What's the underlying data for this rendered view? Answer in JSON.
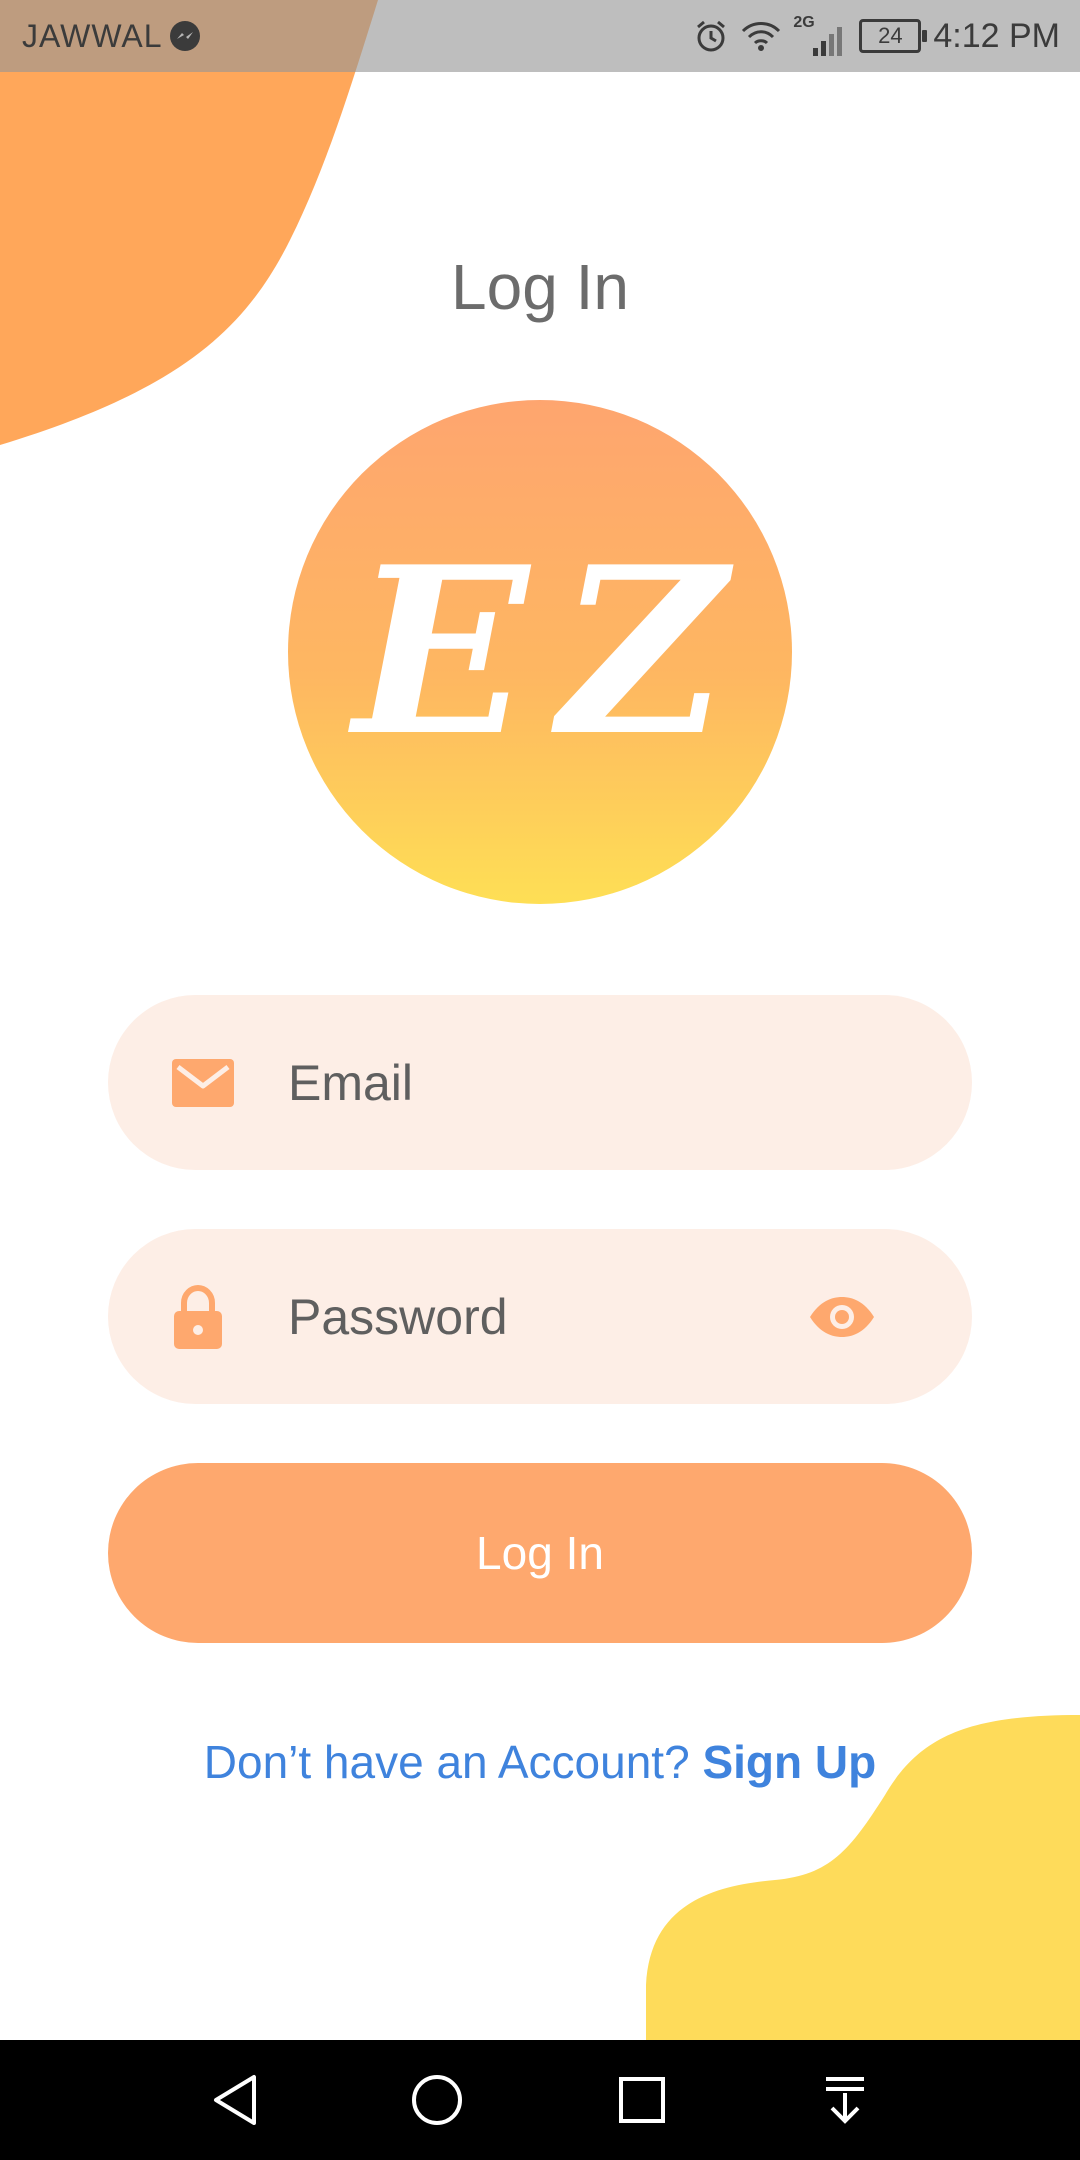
{
  "status_bar": {
    "carrier": "JAWWAL",
    "network_type": "2G",
    "battery": "24",
    "time": "4:12 PM",
    "icons": [
      "messenger-icon",
      "alarm-icon",
      "wifi-icon",
      "signal-icon",
      "battery-icon"
    ]
  },
  "login": {
    "title": "Log In",
    "logo_text": "EZ",
    "email": {
      "placeholder": "Email",
      "value": "",
      "icon": "mail-icon"
    },
    "password": {
      "placeholder": "Password",
      "value": "",
      "icon": "lock-icon",
      "toggle_icon": "eye-icon"
    },
    "submit_label": "Log In",
    "signup_prompt": "Don’t have an Account?",
    "signup_link": "Sign Up"
  },
  "nav_bar": {
    "buttons": [
      "back-icon",
      "home-icon",
      "recents-icon",
      "notifications-pulldown-icon"
    ]
  },
  "colors": {
    "accent_orange": "#fea86e",
    "field_bg": "#fdeee6",
    "blob_orange": "#ffa75a",
    "blob_yellow": "#fedb5a",
    "link_blue": "#3f83dd",
    "title_gray": "#6c6c6c"
  }
}
